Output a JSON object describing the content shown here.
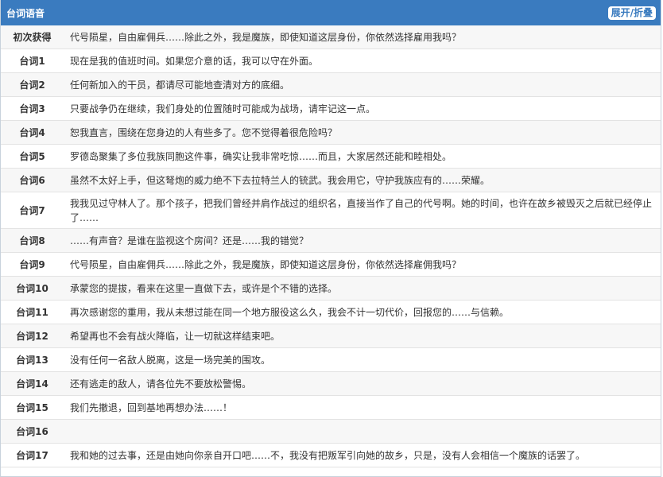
{
  "header": {
    "title": "台词语音",
    "toggle_label": "展开/折叠"
  },
  "rows": [
    {
      "label": "初次获得",
      "text": "代号陨星，自由雇佣兵……除此之外，我是魔族，即使知道这层身份，你依然选择雇用我吗？"
    },
    {
      "label": "台词1",
      "text": "现在是我的值班时间。如果您介意的话，我可以守在外面。"
    },
    {
      "label": "台词2",
      "text": "任何新加入的干员，都请尽可能地查清对方的底细。"
    },
    {
      "label": "台词3",
      "text": "只要战争仍在继续，我们身处的位置随时可能成为战场，请牢记这一点。"
    },
    {
      "label": "台词4",
      "text": "恕我直言，围绕在您身边的人有些多了。您不觉得着很危险吗？"
    },
    {
      "label": "台词5",
      "text": "罗德岛聚集了多位我族同胞这件事，确实让我非常吃惊……而且，大家居然还能和睦相处。"
    },
    {
      "label": "台词6",
      "text": "虽然不太好上手，但这弩炮的威力绝不下去拉特兰人的铳武。我会用它，守护我族应有的……荣耀。"
    },
    {
      "label": "台词7",
      "text": "我我见过守林人了。那个孩子，把我们曾经并肩作战过的组织名，直接当作了自己的代号啊。她的时间，也许在故乡被毁灭之后就已经停止了……"
    },
    {
      "label": "台词8",
      "text": "……有声音？是谁在监视这个房间？还是……我的错觉？"
    },
    {
      "label": "台词9",
      "text": "代号陨星，自由雇佣兵……除此之外，我是魔族，即使知道这层身份，你依然选择雇佣我吗？"
    },
    {
      "label": "台词10",
      "text": "承蒙您的提拔，看来在这里一直做下去，或许是个不错的选择。"
    },
    {
      "label": "台词11",
      "text": "再次感谢您的重用，我从未想过能在同一个地方服役这么久，我会不计一切代价，回报您的……与信赖。"
    },
    {
      "label": "台词12",
      "text": "希望再也不会有战火降临，让一切就这样结束吧。"
    },
    {
      "label": "台词13",
      "text": "没有任何一名敌人脱离，这是一场完美的围攻。"
    },
    {
      "label": "台词14",
      "text": "还有逃走的敌人，请各位先不要放松警惕。"
    },
    {
      "label": "台词15",
      "text": "我们先撤退，回到基地再想办法……！"
    },
    {
      "label": "台词16",
      "text": ""
    },
    {
      "label": "台词17",
      "text": "我和她的过去事，还是由她向你亲自开口吧……不，我没有把叛军引向她的故乡，只是，没有人会相信一个魔族的话罢了。"
    }
  ]
}
